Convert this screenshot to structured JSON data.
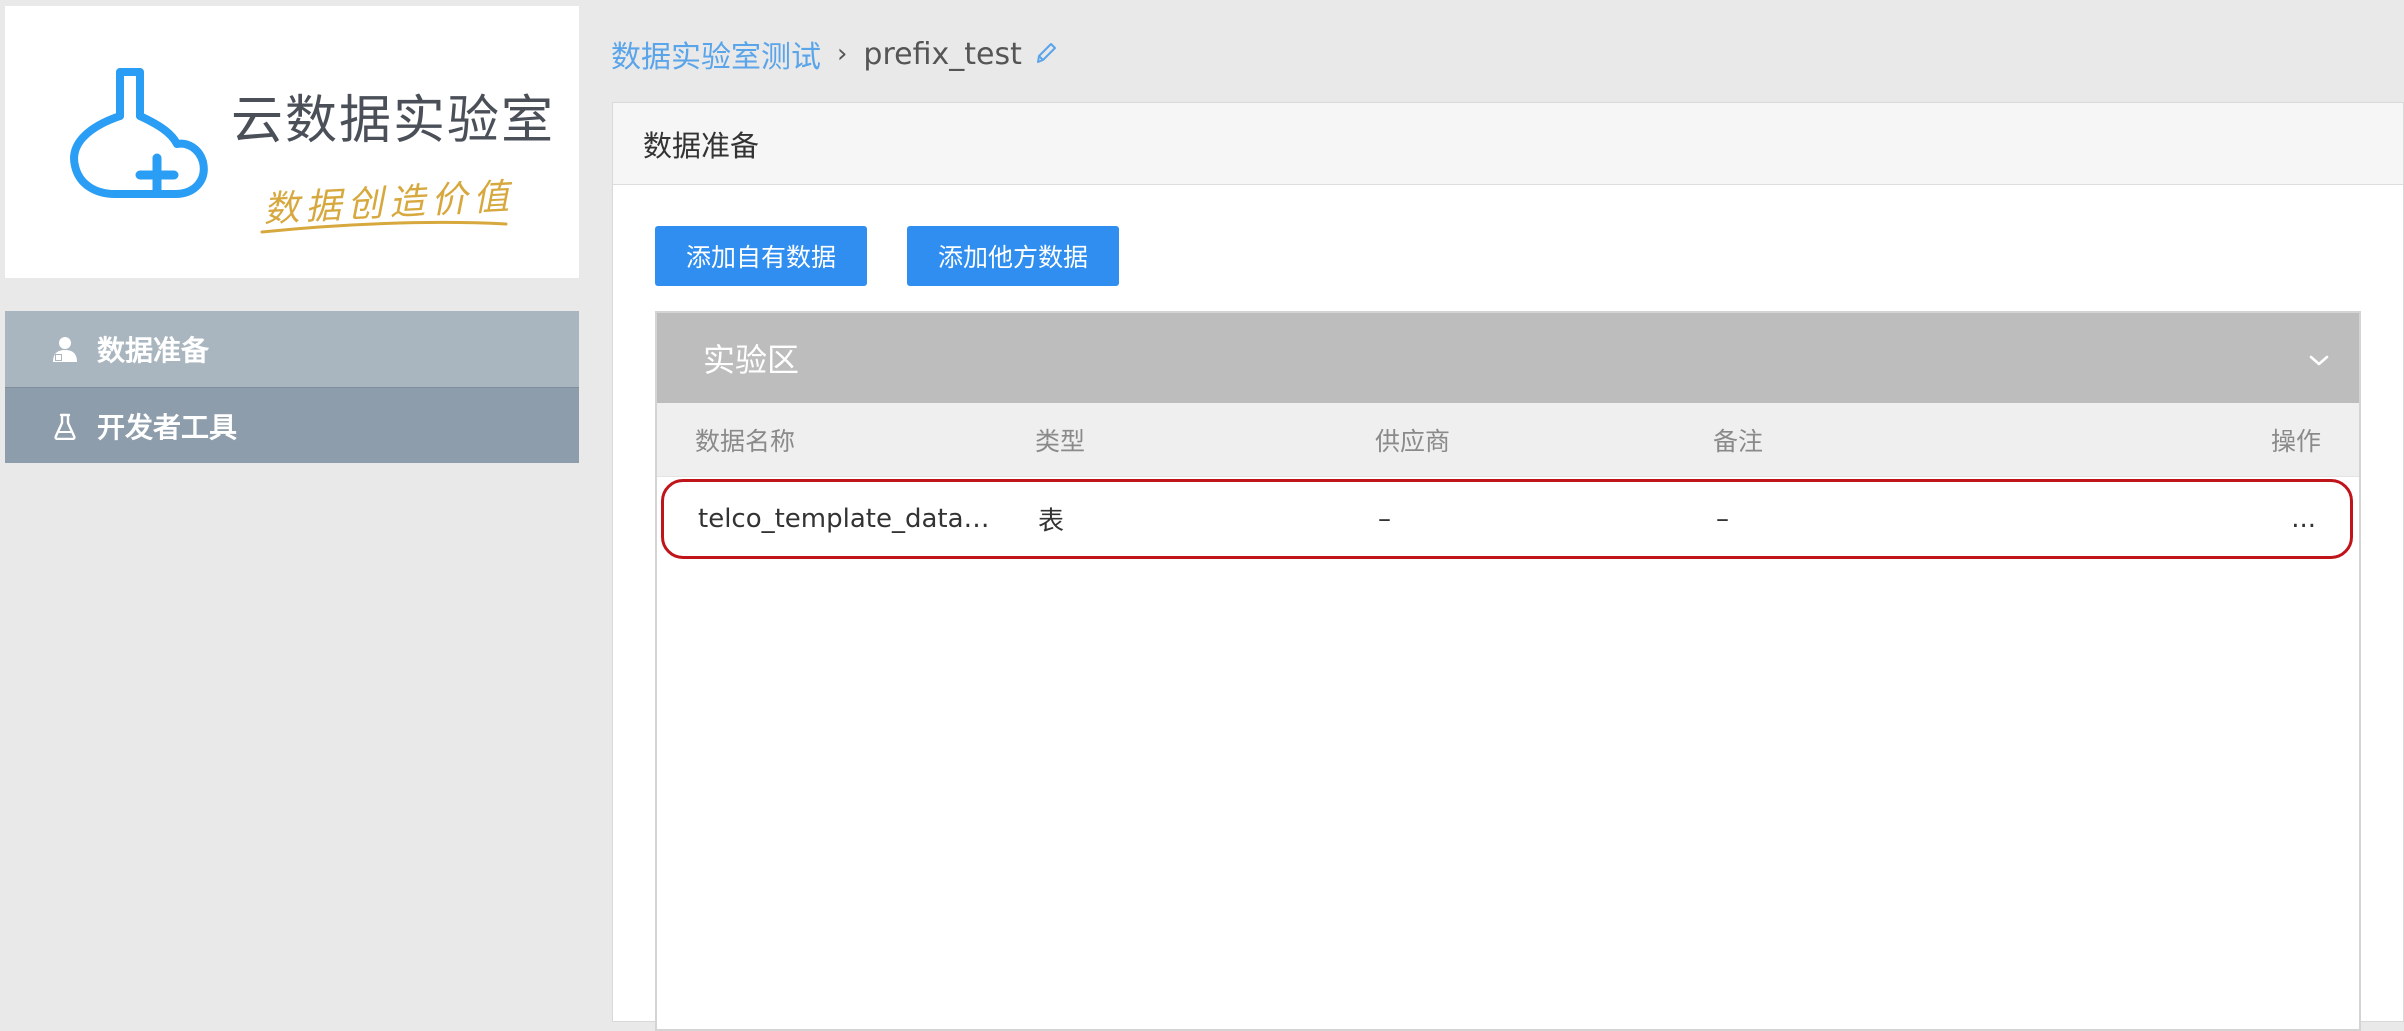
{
  "logo": {
    "title": "云数据实验室",
    "slogan": "数据创造价值",
    "brand_color": "#2a9df4",
    "slogan_color": "#d7a83e"
  },
  "sidebar": {
    "items": [
      {
        "label": "数据准备",
        "icon": "user-icon",
        "active": true
      },
      {
        "label": "开发者工具",
        "icon": "flask-icon",
        "active": false
      }
    ]
  },
  "breadcrumb": {
    "parent": "数据实验室测试",
    "separator": "›",
    "current": "prefix_test",
    "edit_icon": "pencil-icon"
  },
  "panel": {
    "title": "数据准备",
    "buttons": {
      "add_own": "添加自有数据",
      "add_other": "添加他方数据"
    },
    "section": {
      "title": "实验区",
      "toggle_icon": "chevron-down-icon",
      "columns": [
        "数据名称",
        "类型",
        "供应商",
        "备注",
        "操作"
      ],
      "rows": [
        {
          "name": "telco_template_data…",
          "type": "表",
          "vendor": "–",
          "note": "–",
          "action": "..."
        }
      ]
    }
  },
  "colors": {
    "accent": "#2f8ef0",
    "link": "#5aa4ea",
    "nav_active": "#aab6bf",
    "nav_normal": "#8e9dab",
    "highlight": "#c0141b"
  }
}
